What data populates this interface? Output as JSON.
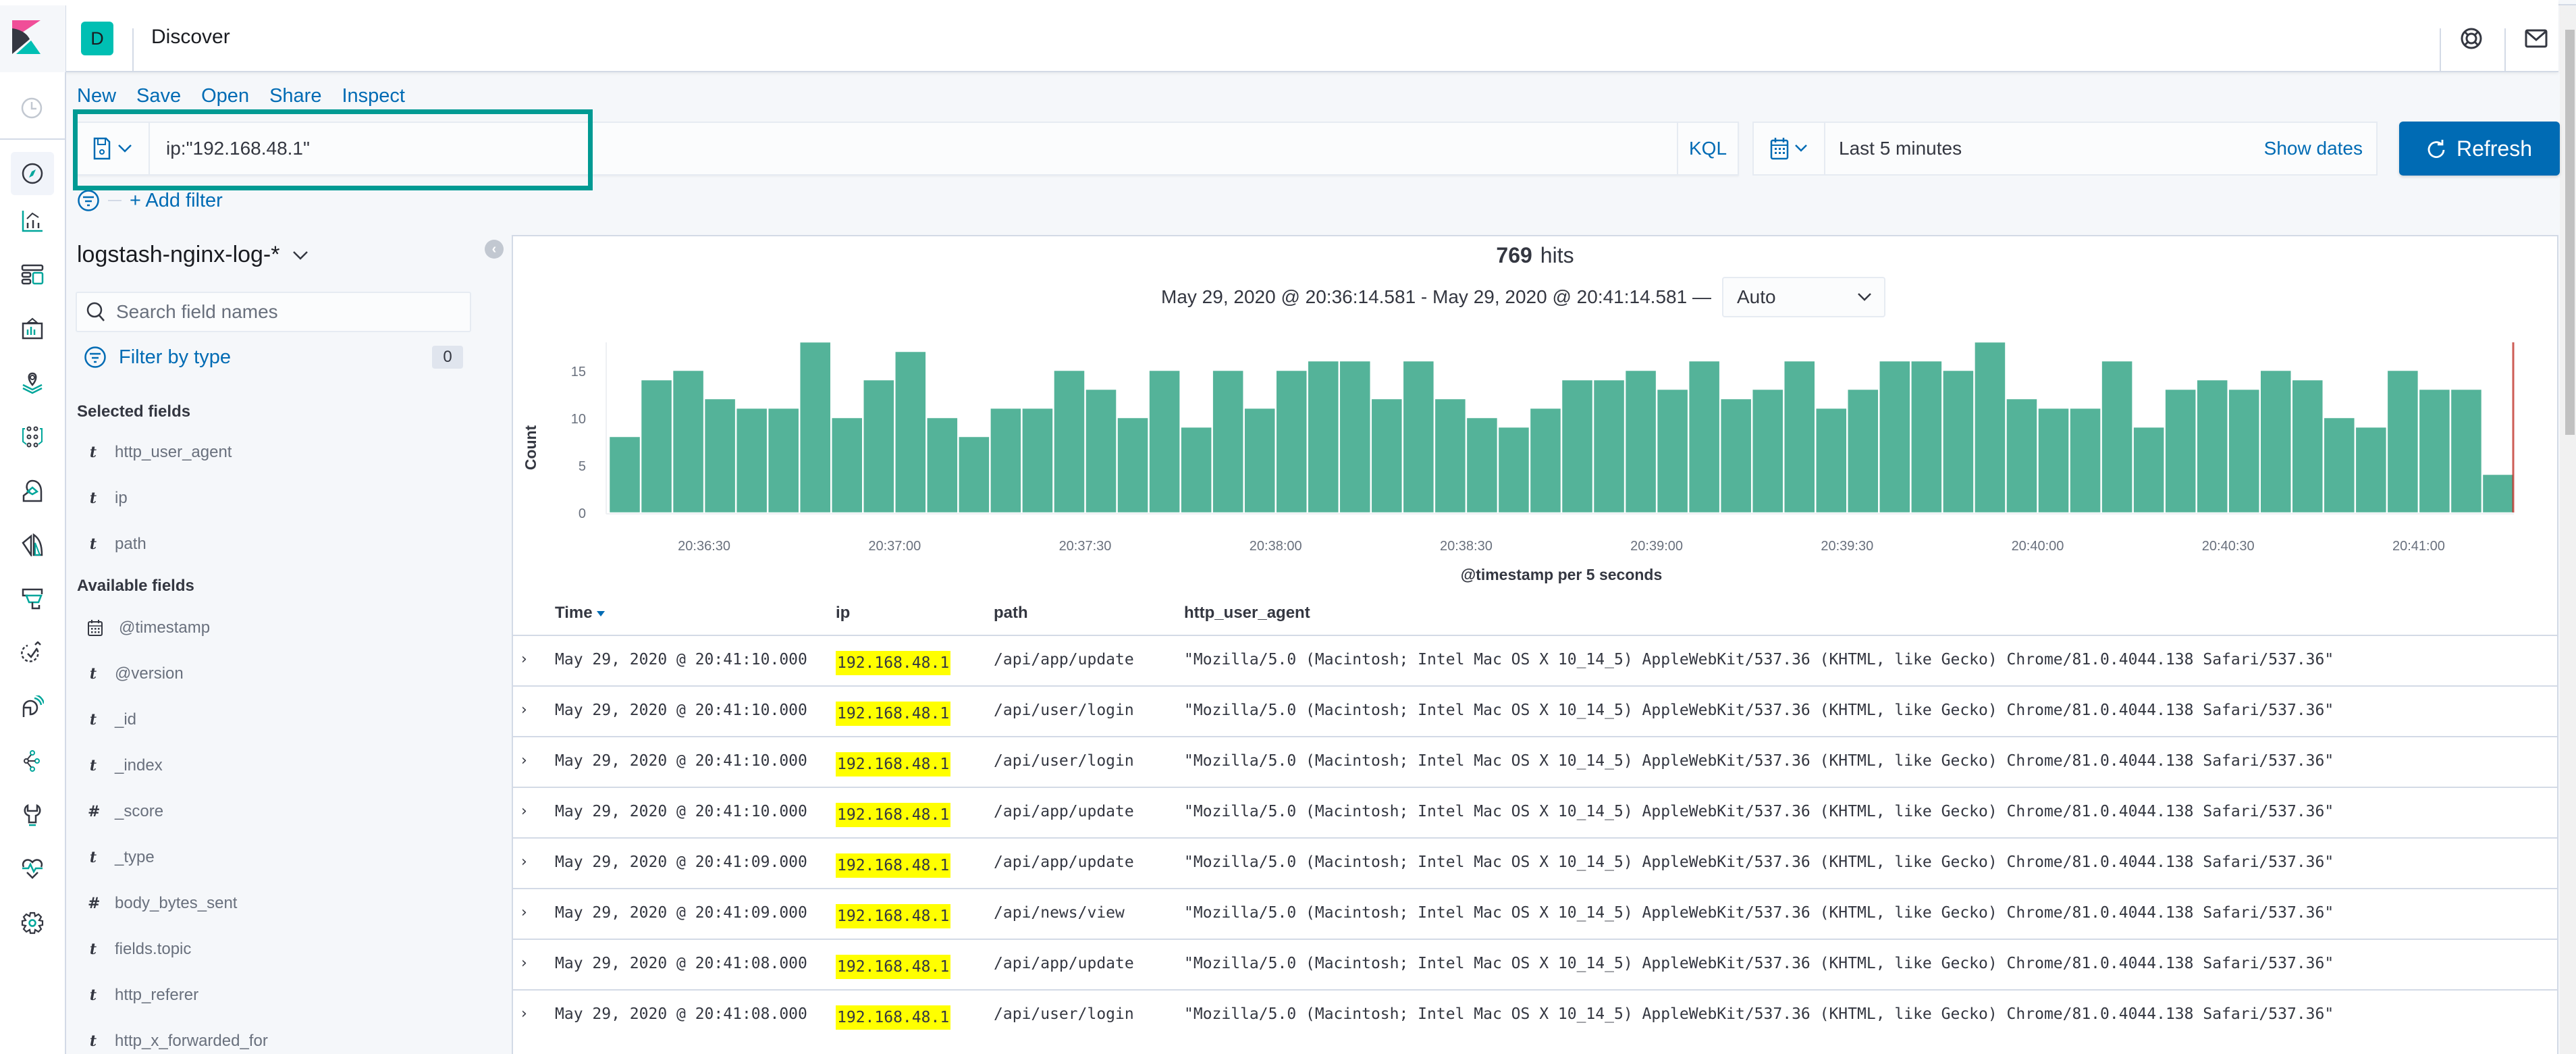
{
  "app": {
    "space_initial": "D",
    "page_title": "Discover",
    "header_icons": [
      "help-icon",
      "mail-icon"
    ]
  },
  "nav_icons": [
    "recently-viewed-icon",
    "discover-icon",
    "visualize-icon",
    "dashboard-icon",
    "canvas-icon",
    "maps-icon",
    "machine-learning-icon",
    "siem-icon",
    "logs-icon",
    "infrastructure-icon",
    "uptime-icon",
    "apm-icon",
    "graph-icon",
    "dev-tools-icon",
    "monitoring-icon",
    "management-icon"
  ],
  "toolbar": {
    "new": "New",
    "save": "Save",
    "open": "Open",
    "share": "Share",
    "inspect": "Inspect"
  },
  "query": {
    "value": "ip:\"192.168.48.1\"",
    "language": "KQL"
  },
  "date_picker": {
    "range": "Last 5 minutes",
    "show_dates": "Show dates"
  },
  "refresh_label": "Refresh",
  "add_filter": "+ Add filter",
  "sidebar": {
    "index_pattern": "logstash-nginx-log-*",
    "search_placeholder": "Search field names",
    "filter_by_type": "Filter by type",
    "filter_count": "0",
    "selected_title": "Selected fields",
    "selected_fields": [
      {
        "type": "t",
        "name": "http_user_agent"
      },
      {
        "type": "t",
        "name": "ip"
      },
      {
        "type": "t",
        "name": "path"
      }
    ],
    "available_title": "Available fields",
    "available_fields": [
      {
        "type": "date",
        "name": "@timestamp"
      },
      {
        "type": "t",
        "name": "@version"
      },
      {
        "type": "t",
        "name": "_id"
      },
      {
        "type": "t",
        "name": "_index"
      },
      {
        "type": "#",
        "name": "_score"
      },
      {
        "type": "t",
        "name": "_type"
      },
      {
        "type": "#",
        "name": "body_bytes_sent"
      },
      {
        "type": "t",
        "name": "fields.topic"
      },
      {
        "type": "t",
        "name": "http_referer"
      },
      {
        "type": "t",
        "name": "http_x_forwarded_for"
      }
    ]
  },
  "results": {
    "hits_count": "769",
    "hits_label": "hits",
    "time_range": "May 29, 2020 @ 20:36:14.581 - May 29, 2020 @ 20:41:14.581 —",
    "interval": "Auto"
  },
  "chart_data": {
    "type": "bar",
    "title": "",
    "xlabel": "@timestamp per 5 seconds",
    "ylabel": "Count",
    "ylim": [
      0,
      18
    ],
    "yticks": [
      0,
      5,
      10,
      15
    ],
    "xticks": [
      "20:36:30",
      "20:37:00",
      "20:37:30",
      "20:38:00",
      "20:38:30",
      "20:39:00",
      "20:39:30",
      "20:40:00",
      "20:40:30",
      "20:41:00"
    ],
    "interval_seconds": 5,
    "start": "20:36:15",
    "values": [
      8,
      14,
      15,
      12,
      11,
      11,
      18,
      10,
      14,
      17,
      10,
      8,
      11,
      11,
      15,
      13,
      10,
      15,
      9,
      15,
      11,
      15,
      16,
      16,
      12,
      16,
      12,
      10,
      9,
      11,
      14,
      14,
      15,
      13,
      16,
      12,
      13,
      16,
      11,
      13,
      16,
      16,
      15,
      18,
      12,
      11,
      11,
      16,
      9,
      13,
      14,
      13,
      15,
      14,
      10,
      9,
      15,
      13,
      13,
      4
    ],
    "color": "#54b399",
    "now_marker_color": "#bd271e",
    "grid": false,
    "legend": "none"
  },
  "table": {
    "columns": [
      "Time",
      "ip",
      "path",
      "http_user_agent"
    ],
    "rows": [
      {
        "time": "May 29, 2020 @ 20:41:10.000",
        "ip": "192.168.48.1",
        "path": "/api/app/update",
        "agent": "\"Mozilla/5.0 (Macintosh; Intel Mac OS X 10_14_5) AppleWebKit/537.36 (KHTML, like Gecko) Chrome/81.0.4044.138 Safari/537.36\""
      },
      {
        "time": "May 29, 2020 @ 20:41:10.000",
        "ip": "192.168.48.1",
        "path": "/api/user/login",
        "agent": "\"Mozilla/5.0 (Macintosh; Intel Mac OS X 10_14_5) AppleWebKit/537.36 (KHTML, like Gecko) Chrome/81.0.4044.138 Safari/537.36\""
      },
      {
        "time": "May 29, 2020 @ 20:41:10.000",
        "ip": "192.168.48.1",
        "path": "/api/user/login",
        "agent": "\"Mozilla/5.0 (Macintosh; Intel Mac OS X 10_14_5) AppleWebKit/537.36 (KHTML, like Gecko) Chrome/81.0.4044.138 Safari/537.36\""
      },
      {
        "time": "May 29, 2020 @ 20:41:10.000",
        "ip": "192.168.48.1",
        "path": "/api/app/update",
        "agent": "\"Mozilla/5.0 (Macintosh; Intel Mac OS X 10_14_5) AppleWebKit/537.36 (KHTML, like Gecko) Chrome/81.0.4044.138 Safari/537.36\""
      },
      {
        "time": "May 29, 2020 @ 20:41:09.000",
        "ip": "192.168.48.1",
        "path": "/api/app/update",
        "agent": "\"Mozilla/5.0 (Macintosh; Intel Mac OS X 10_14_5) AppleWebKit/537.36 (KHTML, like Gecko) Chrome/81.0.4044.138 Safari/537.36\""
      },
      {
        "time": "May 29, 2020 @ 20:41:09.000",
        "ip": "192.168.48.1",
        "path": "/api/news/view",
        "agent": "\"Mozilla/5.0 (Macintosh; Intel Mac OS X 10_14_5) AppleWebKit/537.36 (KHTML, like Gecko) Chrome/81.0.4044.138 Safari/537.36\""
      },
      {
        "time": "May 29, 2020 @ 20:41:08.000",
        "ip": "192.168.48.1",
        "path": "/api/app/update",
        "agent": "\"Mozilla/5.0 (Macintosh; Intel Mac OS X 10_14_5) AppleWebKit/537.36 (KHTML, like Gecko) Chrome/81.0.4044.138 Safari/537.36\""
      },
      {
        "time": "May 29, 2020 @ 20:41:08.000",
        "ip": "192.168.48.1",
        "path": "/api/user/login",
        "agent": "\"Mozilla/5.0 (Macintosh; Intel Mac OS X 10_14_5) AppleWebKit/537.36 (KHTML, like Gecko) Chrome/81.0.4044.138 Safari/537.36\""
      }
    ]
  }
}
